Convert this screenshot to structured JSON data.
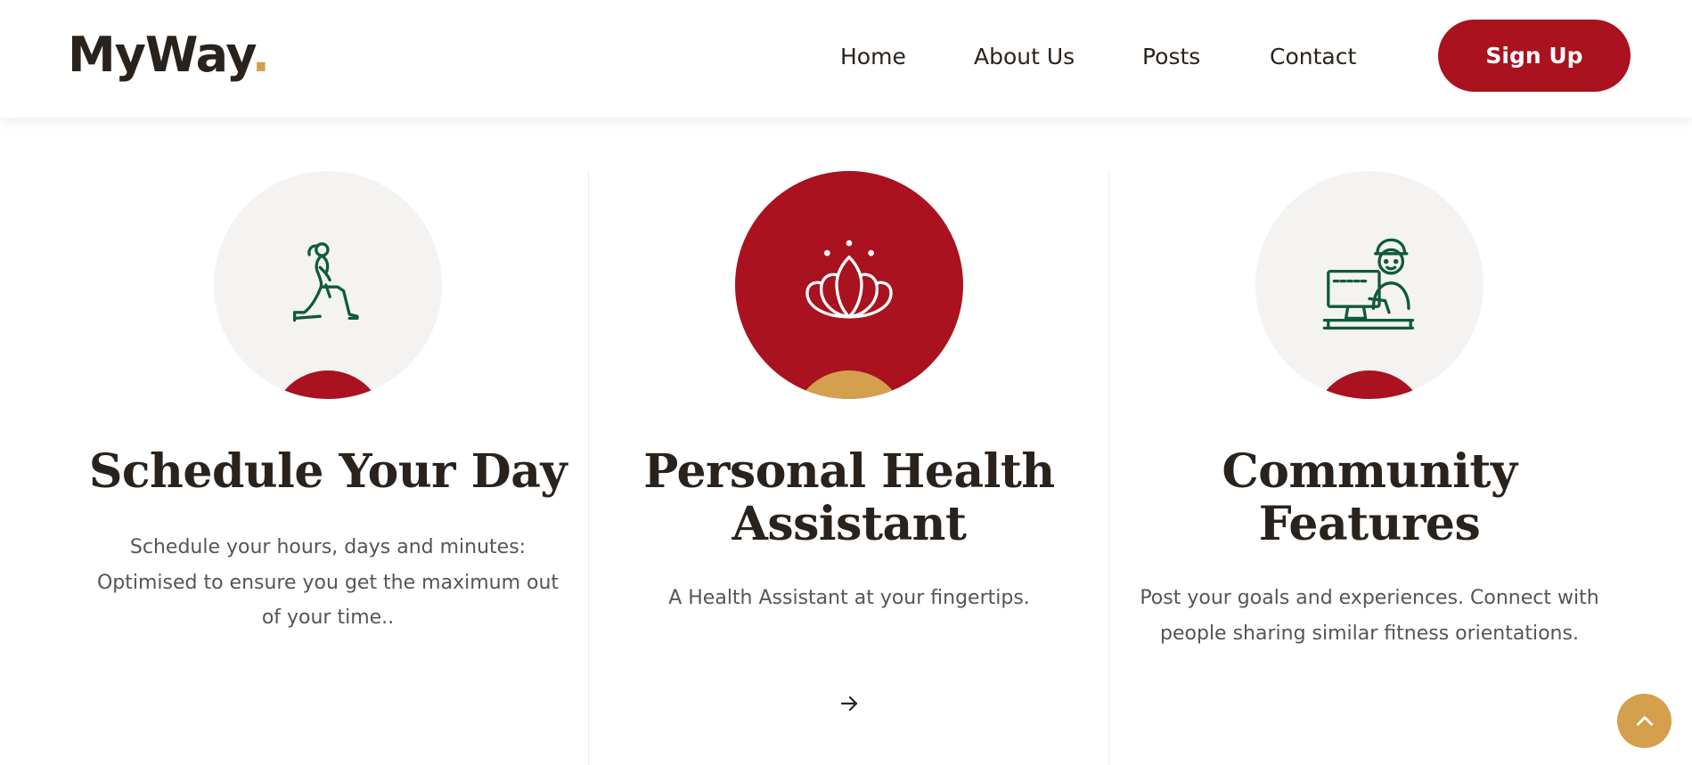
{
  "header": {
    "logo_text": "MyWay",
    "logo_dot": ".",
    "nav": [
      {
        "label": "Home"
      },
      {
        "label": "About Us"
      },
      {
        "label": "Posts"
      },
      {
        "label": "Contact"
      }
    ],
    "signup_label": "Sign Up"
  },
  "features": [
    {
      "icon": "lunge-exercise-icon",
      "title": "Schedule Your Day",
      "text": "Schedule your hours, days and minutes: Optimised to ensure you get the maximum out of your time.."
    },
    {
      "icon": "lotus-icon",
      "title": "Personal Health Assistant",
      "text": "A Health Assistant at your fingertips.",
      "link_icon": "arrow-right-icon"
    },
    {
      "icon": "person-at-computer-icon",
      "title": "Community Features",
      "text": "Post your goals and experiences. Connect with people sharing similar fitness orientations."
    }
  ],
  "scroll_top_icon": "chevron-up-icon",
  "colors": {
    "brand_red": "#a9121e",
    "accent_gold": "#d4a04e",
    "icon_green": "#0f5a3c",
    "text_dark": "#2a221c",
    "circle_light": "#f4f3f2"
  }
}
